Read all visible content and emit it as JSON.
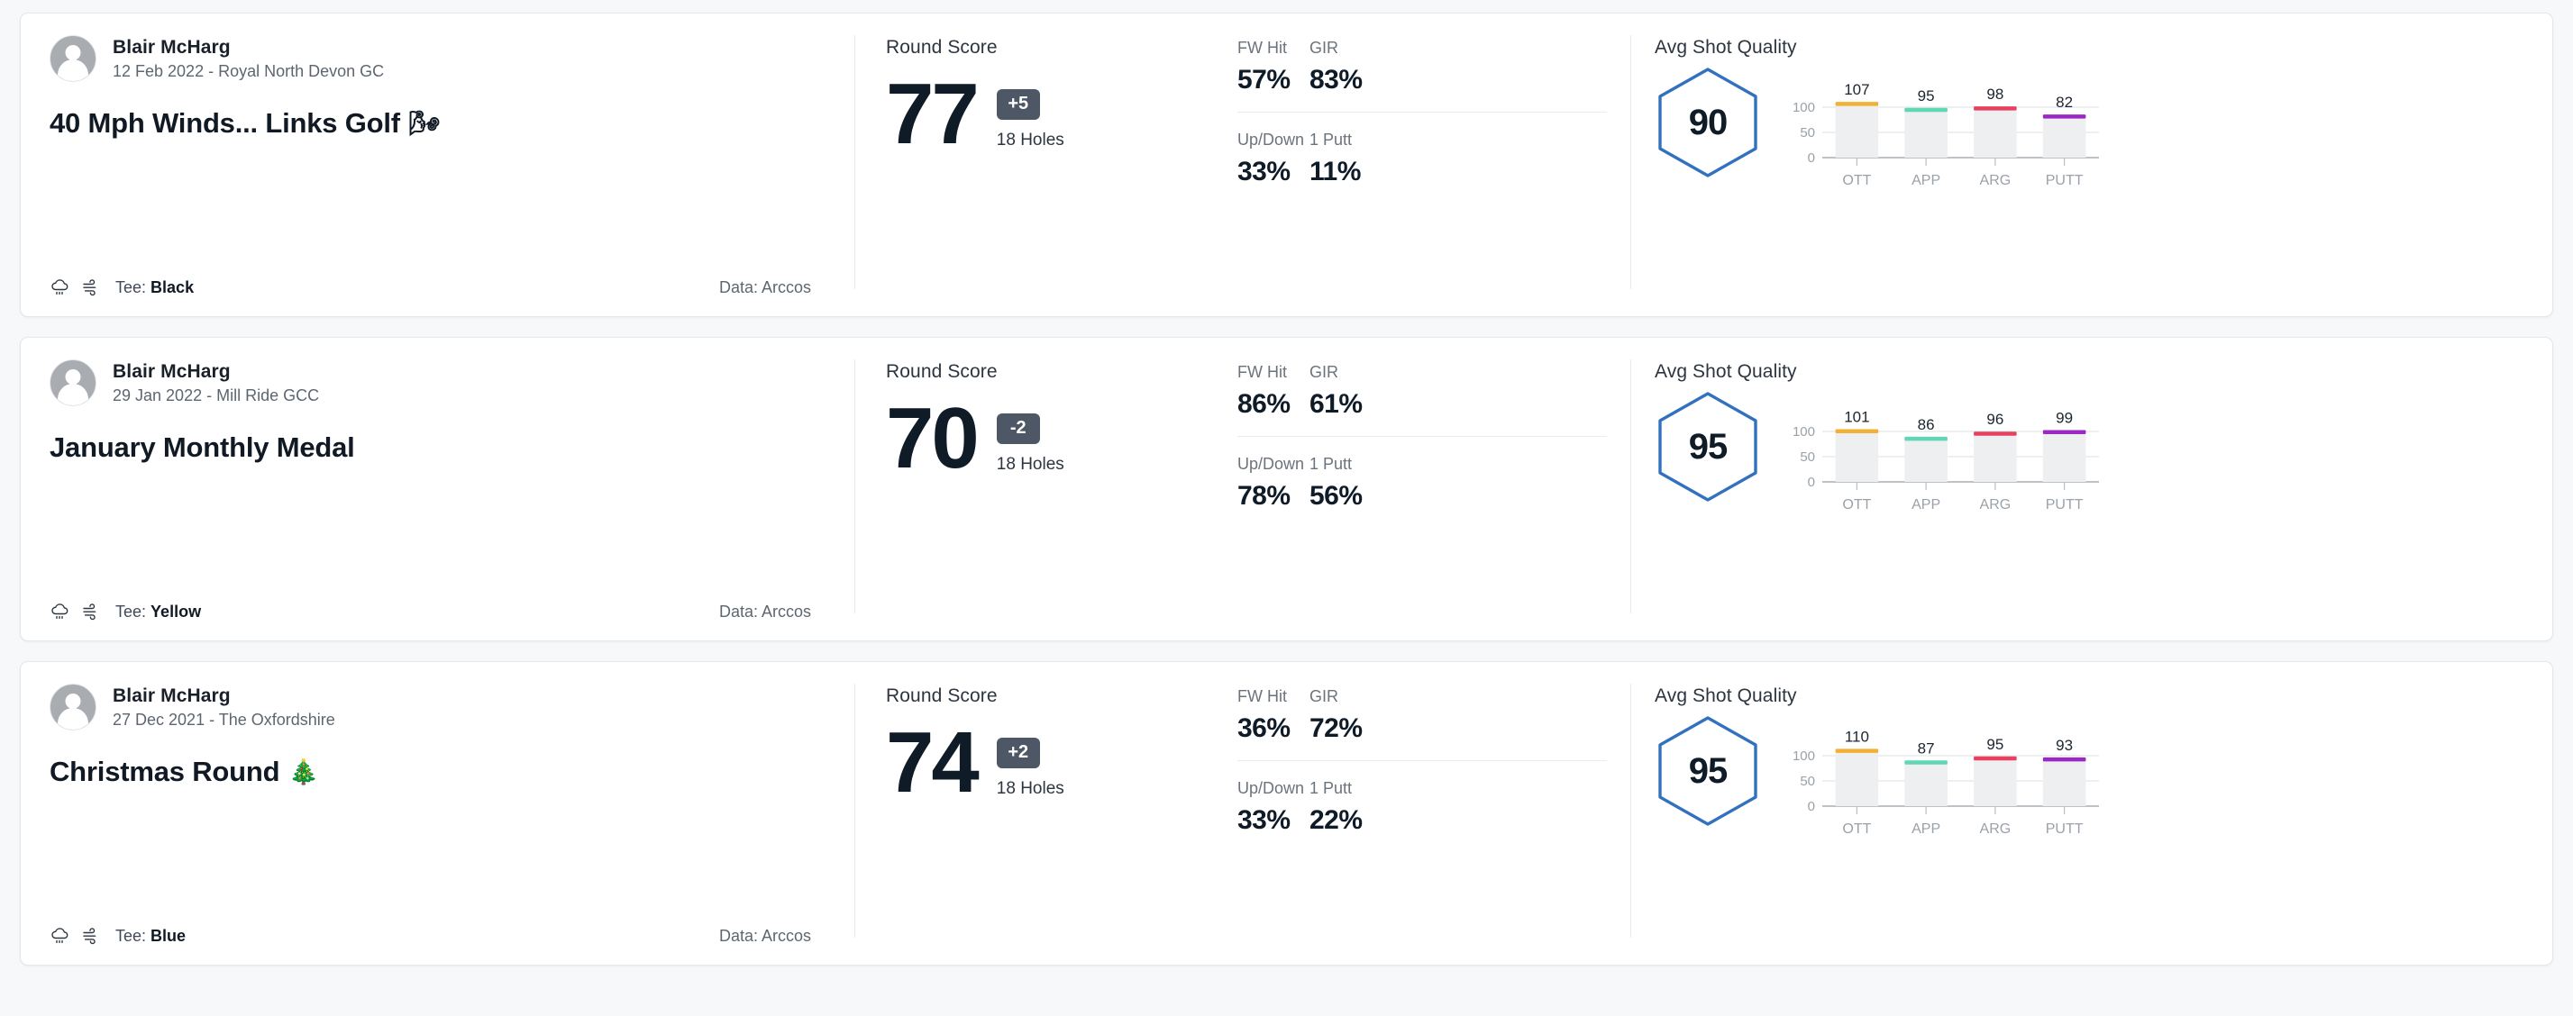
{
  "cards": [
    {
      "player": "Blair McHarg",
      "meta": "12 Feb 2022 - Royal North Devon GC",
      "title": "40 Mph Winds... Links Golf",
      "title_emoji": "🌬",
      "tee_prefix": "Tee:",
      "tee": "Black",
      "data_source": "Data: Arccos",
      "score_label": "Round Score",
      "score": "77",
      "score_diff": "+5",
      "holes": "18 Holes",
      "stats": [
        {
          "name": "FW Hit",
          "value": "57%"
        },
        {
          "name": "GIR",
          "value": "83%"
        },
        {
          "name": "Up/Down",
          "value": "33%"
        },
        {
          "name": "1 Putt",
          "value": "11%"
        }
      ],
      "quality_label": "Avg Shot Quality",
      "quality_score": "90",
      "chart_data": {
        "type": "bar",
        "title": "Avg Shot Quality",
        "categories": [
          "OTT",
          "APP",
          "ARG",
          "PUTT"
        ],
        "values": [
          107,
          95,
          98,
          82
        ],
        "colors": [
          "#F2B134",
          "#5FD6B4",
          "#E8415F",
          "#9B27C4"
        ],
        "yticks": [
          0,
          50,
          100
        ],
        "ylim": [
          0,
          125
        ],
        "grid": true,
        "xlabel": "",
        "ylabel": ""
      }
    },
    {
      "player": "Blair McHarg",
      "meta": "29 Jan 2022 - Mill Ride GCC",
      "title": "January Monthly Medal",
      "title_emoji": "",
      "tee_prefix": "Tee:",
      "tee": "Yellow",
      "data_source": "Data: Arccos",
      "score_label": "Round Score",
      "score": "70",
      "score_diff": "-2",
      "holes": "18 Holes",
      "stats": [
        {
          "name": "FW Hit",
          "value": "86%"
        },
        {
          "name": "GIR",
          "value": "61%"
        },
        {
          "name": "Up/Down",
          "value": "78%"
        },
        {
          "name": "1 Putt",
          "value": "56%"
        }
      ],
      "quality_label": "Avg Shot Quality",
      "quality_score": "95",
      "chart_data": {
        "type": "bar",
        "title": "Avg Shot Quality",
        "categories": [
          "OTT",
          "APP",
          "ARG",
          "PUTT"
        ],
        "values": [
          101,
          86,
          96,
          99
        ],
        "colors": [
          "#F2B134",
          "#5FD6B4",
          "#E8415F",
          "#9B27C4"
        ],
        "yticks": [
          0,
          50,
          100
        ],
        "ylim": [
          0,
          125
        ],
        "grid": true,
        "xlabel": "",
        "ylabel": ""
      }
    },
    {
      "player": "Blair McHarg",
      "meta": "27 Dec 2021 - The Oxfordshire",
      "title": "Christmas Round",
      "title_emoji": "🎄",
      "tee_prefix": "Tee:",
      "tee": "Blue",
      "data_source": "Data: Arccos",
      "score_label": "Round Score",
      "score": "74",
      "score_diff": "+2",
      "holes": "18 Holes",
      "stats": [
        {
          "name": "FW Hit",
          "value": "36%"
        },
        {
          "name": "GIR",
          "value": "72%"
        },
        {
          "name": "Up/Down",
          "value": "33%"
        },
        {
          "name": "1 Putt",
          "value": "22%"
        }
      ],
      "quality_label": "Avg Shot Quality",
      "quality_score": "95",
      "chart_data": {
        "type": "bar",
        "title": "Avg Shot Quality",
        "categories": [
          "OTT",
          "APP",
          "ARG",
          "PUTT"
        ],
        "values": [
          110,
          87,
          95,
          93
        ],
        "colors": [
          "#F2B134",
          "#5FD6B4",
          "#E8415F",
          "#9B27C4"
        ],
        "yticks": [
          0,
          50,
          100
        ],
        "ylim": [
          0,
          125
        ],
        "grid": true,
        "xlabel": "",
        "ylabel": ""
      }
    }
  ],
  "theme": {
    "hex_stroke": "#3271bd",
    "badge_bg": "#4d5765",
    "bar_track": "#eeeff0"
  }
}
